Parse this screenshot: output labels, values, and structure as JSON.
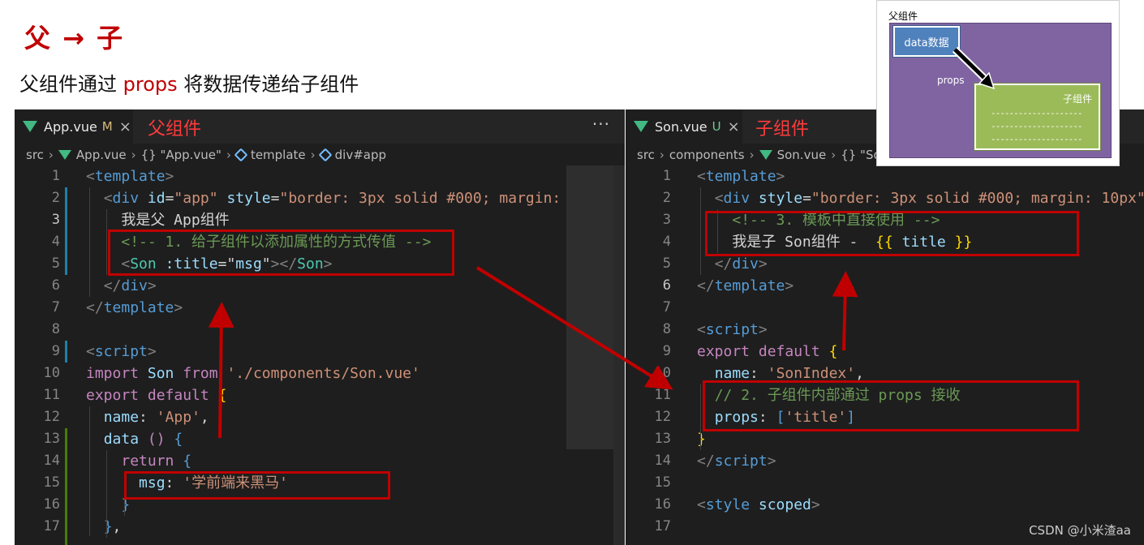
{
  "heading": {
    "title": "父 → 子",
    "subtitle_pre": "父组件通过 ",
    "subtitle_hl": "props",
    "subtitle_post": " 将数据传递给子组件"
  },
  "left_editor": {
    "tab": {
      "name": "App.vue",
      "status": "M",
      "close": "×"
    },
    "caption": "父组件",
    "more": "···",
    "breadcrumb": [
      "src",
      "App.vue",
      "{} \"App.vue\"",
      "template",
      "div#app"
    ],
    "current_line": 3,
    "lines": [
      {
        "n": "1",
        "tokens": [
          [
            "p",
            "<"
          ],
          [
            "t",
            "template"
          ],
          [
            "p",
            ">"
          ]
        ]
      },
      {
        "n": "2",
        "tokens": [
          [
            "w",
            "  "
          ],
          [
            "p",
            "<"
          ],
          [
            "t",
            "div"
          ],
          [
            "w",
            " "
          ],
          [
            "a",
            "id"
          ],
          [
            "w",
            "="
          ],
          [
            "s",
            "\"app\""
          ],
          [
            "w",
            " "
          ],
          [
            "a",
            "style"
          ],
          [
            "w",
            "="
          ],
          [
            "s",
            "\"border: 3px solid #000; margin:"
          ]
        ]
      },
      {
        "n": "3",
        "tokens": [
          [
            "w",
            "    我是父 App组件"
          ]
        ]
      },
      {
        "n": "4",
        "tokens": [
          [
            "w",
            "    "
          ],
          [
            "c",
            "<!-- 1. 给子组件以添加属性的方式传值 -->"
          ]
        ]
      },
      {
        "n": "5",
        "tokens": [
          [
            "w",
            "    "
          ],
          [
            "p",
            "<"
          ],
          [
            "m",
            "Son"
          ],
          [
            "w",
            " "
          ],
          [
            "a",
            ":title"
          ],
          [
            "w",
            "="
          ],
          [
            "w",
            "\""
          ],
          [
            "v",
            "msg"
          ],
          [
            "w",
            "\""
          ],
          [
            "p",
            "></"
          ],
          [
            "m",
            "Son"
          ],
          [
            "p",
            ">"
          ]
        ]
      },
      {
        "n": "6",
        "tokens": [
          [
            "w",
            "  "
          ],
          [
            "p",
            "</"
          ],
          [
            "t",
            "div"
          ],
          [
            "p",
            ">"
          ]
        ]
      },
      {
        "n": "7",
        "tokens": [
          [
            "p",
            "</"
          ],
          [
            "t",
            "template"
          ],
          [
            "p",
            ">"
          ]
        ]
      },
      {
        "n": "8",
        "tokens": [
          [
            "w",
            ""
          ]
        ]
      },
      {
        "n": "9",
        "tokens": [
          [
            "p",
            "<"
          ],
          [
            "t",
            "script"
          ],
          [
            "p",
            ">"
          ]
        ]
      },
      {
        "n": "10",
        "tokens": [
          [
            "k",
            "import"
          ],
          [
            "w",
            " "
          ],
          [
            "v",
            "Son"
          ],
          [
            "w",
            " "
          ],
          [
            "k",
            "from"
          ],
          [
            "w",
            " "
          ],
          [
            "s",
            "'./components/Son.vue'"
          ]
        ]
      },
      {
        "n": "11",
        "tokens": [
          [
            "k",
            "export"
          ],
          [
            "w",
            " "
          ],
          [
            "k",
            "default"
          ],
          [
            "w",
            " "
          ],
          [
            "y",
            "{"
          ]
        ]
      },
      {
        "n": "12",
        "tokens": [
          [
            "w",
            "  "
          ],
          [
            "v",
            "name"
          ],
          [
            "w",
            ": "
          ],
          [
            "s",
            "'App'"
          ],
          [
            "w",
            ","
          ]
        ]
      },
      {
        "n": "13",
        "tokens": [
          [
            "w",
            "  "
          ],
          [
            "v",
            "data"
          ],
          [
            "w",
            " "
          ],
          [
            "k",
            "()"
          ],
          [
            "w",
            " "
          ],
          [
            "b",
            "{"
          ]
        ]
      },
      {
        "n": "14",
        "tokens": [
          [
            "w",
            "    "
          ],
          [
            "k",
            "return"
          ],
          [
            "w",
            " "
          ],
          [
            "b",
            "{"
          ]
        ]
      },
      {
        "n": "15",
        "tokens": [
          [
            "w",
            "      "
          ],
          [
            "v",
            "msg"
          ],
          [
            "w",
            ": "
          ],
          [
            "s",
            "'学前端来黑马'"
          ]
        ]
      },
      {
        "n": "16",
        "tokens": [
          [
            "w",
            "    "
          ],
          [
            "b",
            "}"
          ]
        ]
      },
      {
        "n": "17",
        "tokens": [
          [
            "w",
            "  "
          ],
          [
            "b",
            "}"
          ],
          [
            "w",
            ","
          ]
        ]
      }
    ]
  },
  "right_editor": {
    "tab": {
      "name": "Son.vue",
      "status": "U",
      "close": "×"
    },
    "caption": "子组件",
    "breadcrumb": [
      "src",
      "components",
      "Son.vue",
      "{} \"So"
    ],
    "current_line": 6,
    "lines": [
      {
        "n": "1",
        "tokens": [
          [
            "p",
            "<"
          ],
          [
            "t",
            "template"
          ],
          [
            "p",
            ">"
          ]
        ]
      },
      {
        "n": "2",
        "tokens": [
          [
            "w",
            "  "
          ],
          [
            "p",
            "<"
          ],
          [
            "t",
            "div"
          ],
          [
            "w",
            " "
          ],
          [
            "a",
            "style"
          ],
          [
            "w",
            "="
          ],
          [
            "s",
            "\"border: 3px solid #000; margin: 10px\""
          ],
          [
            "p",
            ">"
          ]
        ]
      },
      {
        "n": "3",
        "tokens": [
          [
            "w",
            "    "
          ],
          [
            "c",
            "<!-- 3. 模板中直接使用 -->"
          ]
        ]
      },
      {
        "n": "4",
        "tokens": [
          [
            "w",
            "    我是子 Son组件 -  "
          ],
          [
            "y",
            "{{"
          ],
          [
            "w",
            " "
          ],
          [
            "v",
            "title"
          ],
          [
            "w",
            " "
          ],
          [
            "y",
            "}}"
          ]
        ]
      },
      {
        "n": "5",
        "tokens": [
          [
            "w",
            "  "
          ],
          [
            "p",
            "</"
          ],
          [
            "t",
            "div"
          ],
          [
            "p",
            ">"
          ]
        ]
      },
      {
        "n": "6",
        "tokens": [
          [
            "p",
            "</"
          ],
          [
            "t",
            "template"
          ],
          [
            "p",
            ">"
          ]
        ]
      },
      {
        "n": "7",
        "tokens": [
          [
            "w",
            ""
          ]
        ]
      },
      {
        "n": "8",
        "tokens": [
          [
            "p",
            "<"
          ],
          [
            "t",
            "script"
          ],
          [
            "p",
            ">"
          ]
        ]
      },
      {
        "n": "9",
        "tokens": [
          [
            "k",
            "export"
          ],
          [
            "w",
            " "
          ],
          [
            "k",
            "default"
          ],
          [
            "w",
            " "
          ],
          [
            "y",
            "{"
          ]
        ]
      },
      {
        "n": "10",
        "tokens": [
          [
            "w",
            "  "
          ],
          [
            "v",
            "name"
          ],
          [
            "w",
            ": "
          ],
          [
            "s",
            "'SonIndex'"
          ],
          [
            "w",
            ","
          ]
        ]
      },
      {
        "n": "11",
        "tokens": [
          [
            "w",
            "  "
          ],
          [
            "c",
            "// 2. 子组件内部通过 props 接收"
          ]
        ]
      },
      {
        "n": "12",
        "tokens": [
          [
            "w",
            "  "
          ],
          [
            "v",
            "props"
          ],
          [
            "w",
            ": "
          ],
          [
            "b",
            "["
          ],
          [
            "s",
            "'title'"
          ],
          [
            "b",
            "]"
          ]
        ]
      },
      {
        "n": "13",
        "tokens": [
          [
            "y",
            "}"
          ]
        ]
      },
      {
        "n": "14",
        "tokens": [
          [
            "p",
            "</"
          ],
          [
            "t",
            "script"
          ],
          [
            "p",
            ">"
          ]
        ]
      },
      {
        "n": "15",
        "tokens": [
          [
            "w",
            ""
          ]
        ]
      },
      {
        "n": "16",
        "tokens": [
          [
            "p",
            "<"
          ],
          [
            "t",
            "style"
          ],
          [
            "w",
            " "
          ],
          [
            "a",
            "scoped"
          ],
          [
            "p",
            ">"
          ]
        ]
      },
      {
        "n": "17",
        "tokens": [
          [
            "w",
            ""
          ]
        ]
      }
    ]
  },
  "diagram": {
    "title": "父组件",
    "data_box": "data数据",
    "arrow_label": "props",
    "child_box": "子组件",
    "dash_lines": [
      "--------------------",
      "--------------------",
      "--------------------"
    ]
  },
  "watermark": "CSDN @小米渣aa",
  "colors": {
    "accent_red": "#c00000",
    "editor_bg": "#1e1e1e",
    "parent_purple": "#8064a2",
    "child_green": "#9bbb59",
    "data_blue": "#4f81bd"
  }
}
